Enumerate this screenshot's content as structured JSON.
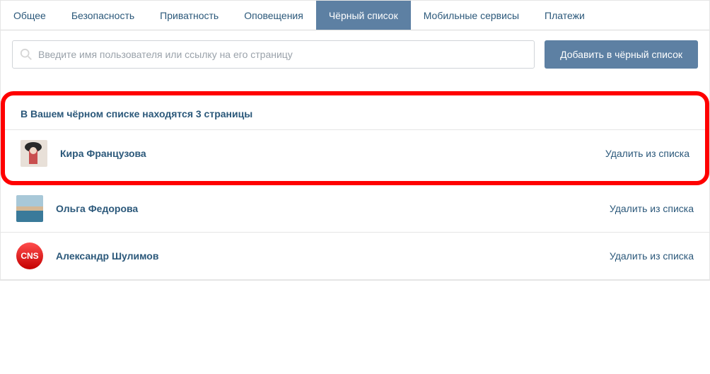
{
  "tabs": [
    {
      "label": "Общее",
      "active": false
    },
    {
      "label": "Безопасность",
      "active": false
    },
    {
      "label": "Приватность",
      "active": false
    },
    {
      "label": "Оповещения",
      "active": false
    },
    {
      "label": "Чёрный список",
      "active": true
    },
    {
      "label": "Мобильные сервисы",
      "active": false
    },
    {
      "label": "Платежи",
      "active": false
    }
  ],
  "search": {
    "placeholder": "Введите имя пользователя или ссылку на его страницу"
  },
  "add_button_label": "Добавить в чёрный список",
  "blacklist_header": "В Вашем чёрном списке находятся 3 страницы",
  "remove_link_label": "Удалить из списка",
  "users": [
    {
      "name": "Кира Французова",
      "avatar_type": "photo1"
    },
    {
      "name": "Ольга Федорова",
      "avatar_type": "photo2"
    },
    {
      "name": "Александр Шулимов",
      "avatar_type": "cns",
      "avatar_text": "CNS"
    }
  ]
}
